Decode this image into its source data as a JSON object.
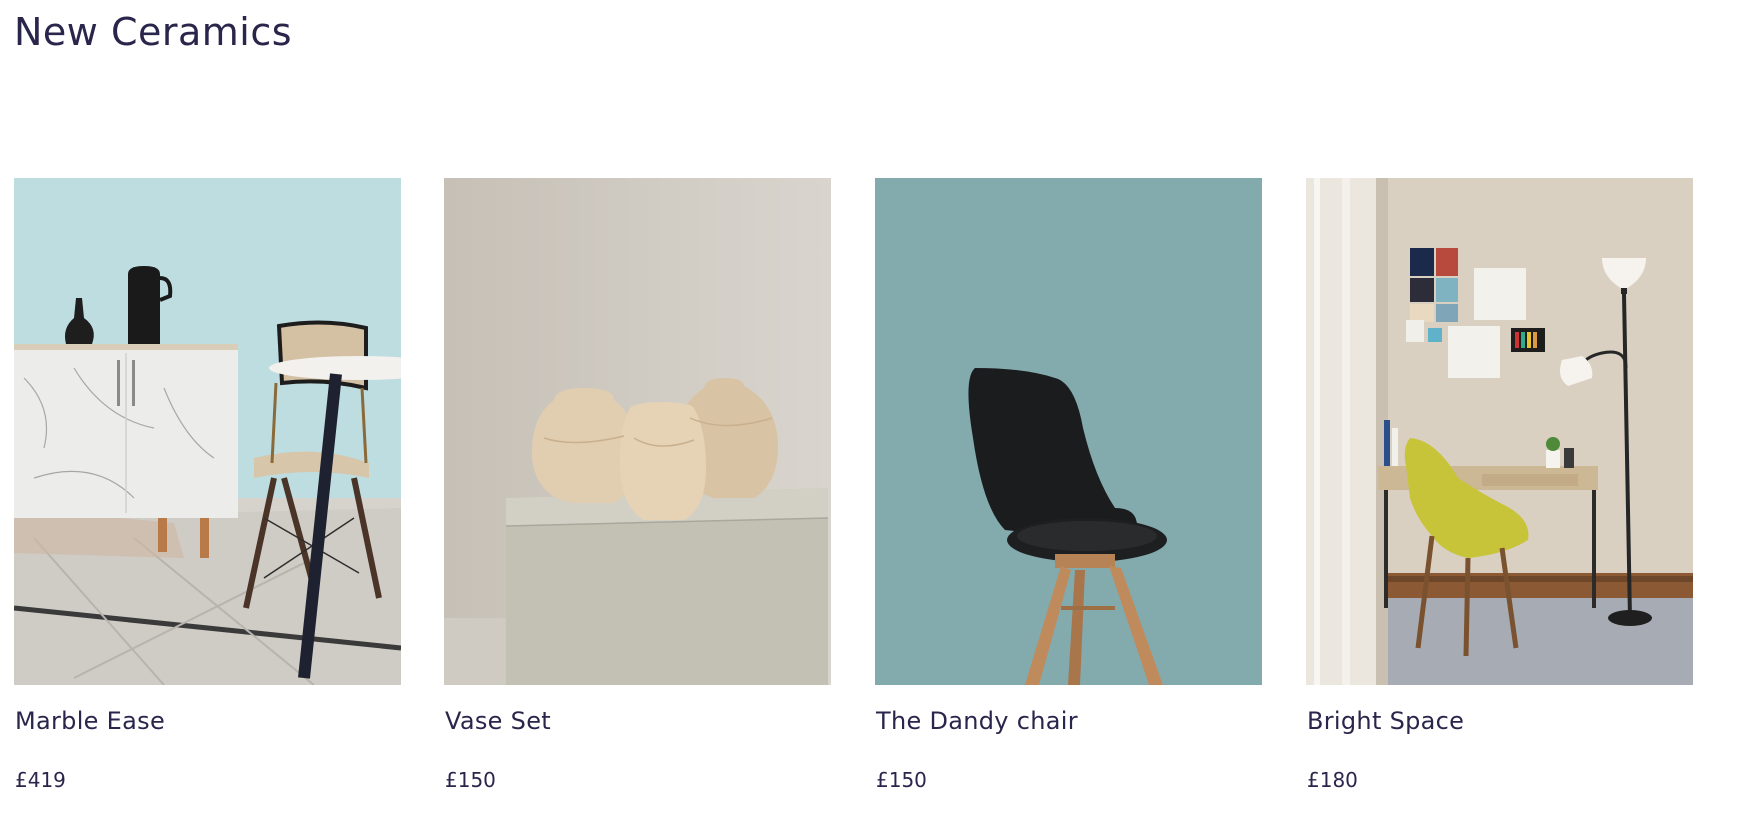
{
  "section": {
    "title": "New Ceramics"
  },
  "products": [
    {
      "name": "Marble Ease",
      "price": "£419",
      "image": "marble sideboard with black vases and dining chair"
    },
    {
      "name": "Vase Set",
      "price": "£150",
      "image": "three textured beige vases on a stone plinth"
    },
    {
      "name": "The Dandy chair",
      "price": "£150",
      "image": "black moulded chair with wooden legs"
    },
    {
      "name": "Bright Space",
      "price": "£180",
      "image": "desk with yellow armchair and floor lamp"
    }
  ],
  "colors": {
    "text": "#2a254b",
    "background": "#ffffff"
  }
}
